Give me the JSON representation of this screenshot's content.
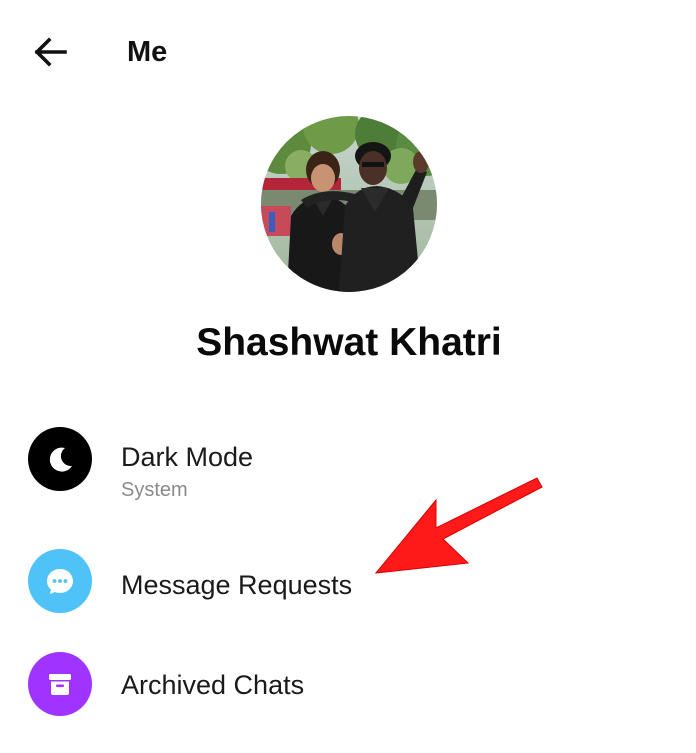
{
  "header": {
    "back_icon": "arrow-left-icon",
    "title": "Me"
  },
  "profile": {
    "name": "Shashwat Khatri",
    "avatar": "profile-photo"
  },
  "menu": {
    "items": [
      {
        "label": "Dark Mode",
        "subtitle": "System",
        "icon": "moon-icon",
        "icon_bg": "#000000"
      },
      {
        "label": "Message Requests",
        "icon": "chat-bubble-icon",
        "icon_bg": "#4fc3f7"
      },
      {
        "label": "Archived Chats",
        "icon": "archive-box-icon",
        "icon_bg": "#a033ff"
      }
    ]
  },
  "annotation": {
    "icon": "red-pointer-arrow",
    "color": "#ff1a1a"
  }
}
